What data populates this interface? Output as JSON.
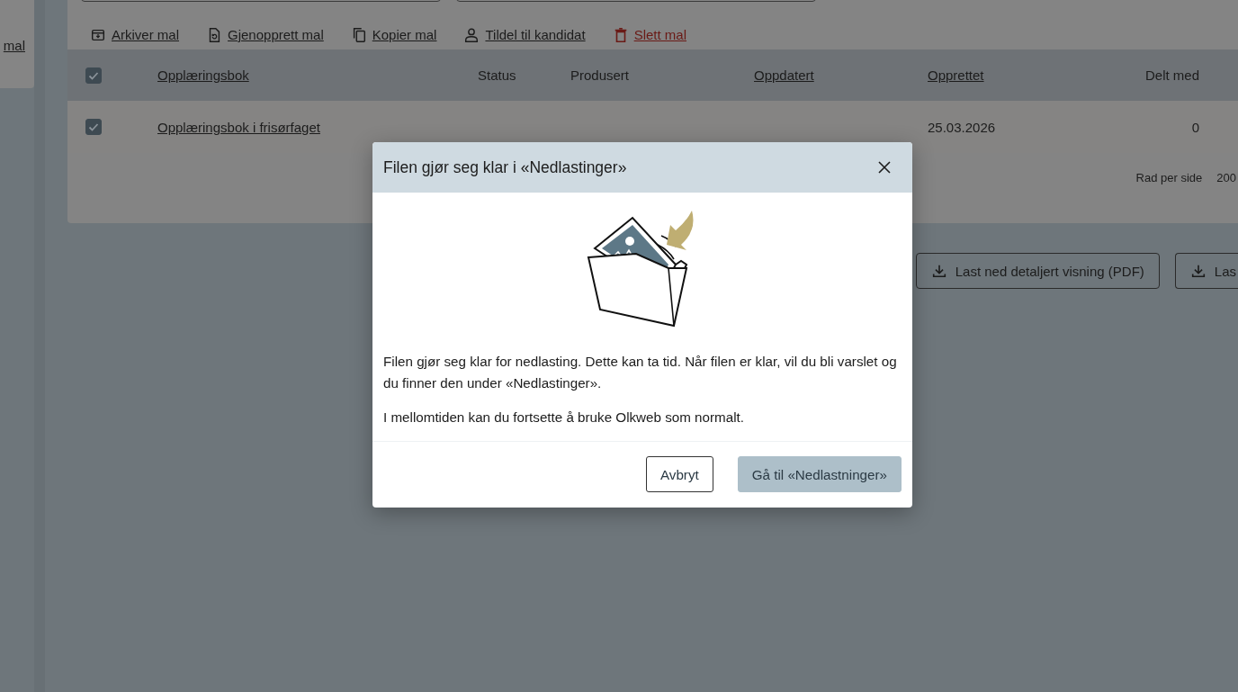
{
  "sidebar": {
    "link": "mal"
  },
  "toolbar": {
    "actions": [
      {
        "label": "Arkiver mal",
        "kind": "normal"
      },
      {
        "label": "Gjenopprett mal",
        "kind": "normal"
      },
      {
        "label": "Kopier mal",
        "kind": "normal"
      },
      {
        "label": "Tildel til kandidat",
        "kind": "normal"
      },
      {
        "label": "Slett mal",
        "kind": "danger"
      }
    ]
  },
  "table": {
    "select_all": {
      "checked": true
    },
    "columns": [
      {
        "label": "Opplæringsbok",
        "sortable": true
      },
      {
        "label": "Status",
        "sortable": false
      },
      {
        "label": "Produsert",
        "sortable": false
      },
      {
        "label": "Oppdatert",
        "sortable": true
      },
      {
        "label": "Opprettet",
        "sortable": true
      },
      {
        "label": "Delt med",
        "sortable": false
      }
    ],
    "rows": [
      {
        "checked": true,
        "title": "Opplæringsbok i frisørfaget",
        "created": "25.03.2026",
        "shared_with": "0"
      }
    ]
  },
  "pagination": {
    "label": "Rad per side",
    "value": "200"
  },
  "downloads": [
    {
      "label": "Last ned detaljert visning (PDF)"
    },
    {
      "label": "Las"
    }
  ],
  "dialog": {
    "title": "Filen gjør seg klar i «Nedlastinger»",
    "paragraphs": [
      "Filen gjør seg klar for nedlasting. Dette kan ta tid. Når filen er klar, vil du bli varslet og du finner den under «Nedlastinger».",
      "I mellomtiden kan du fortsette å bruke Olkweb som normalt."
    ],
    "buttons": [
      {
        "label": "Avbryt",
        "kind": "secondary"
      },
      {
        "label": "Gå til «Nedlastninger»",
        "kind": "primary"
      }
    ]
  }
}
